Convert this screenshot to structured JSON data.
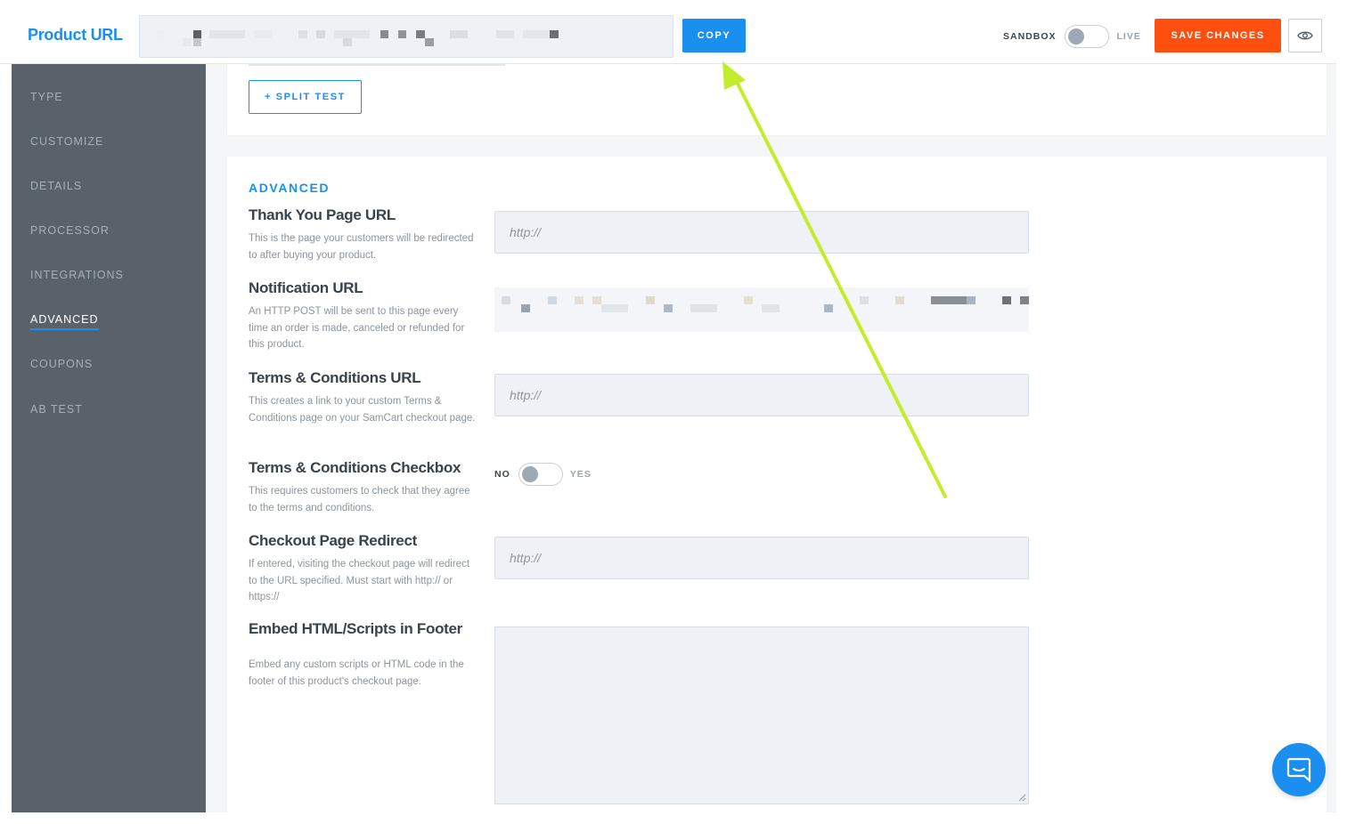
{
  "header": {
    "title": "Product URL",
    "copy_label": "COPY",
    "sandbox_label": "SANDBOX",
    "live_label": "LIVE",
    "save_label": "SAVE CHANGES",
    "eye_icon": "eye-icon",
    "mode": "sandbox"
  },
  "sidebar": {
    "items": [
      {
        "label": "TYPE"
      },
      {
        "label": "CUSTOMIZE"
      },
      {
        "label": "DETAILS"
      },
      {
        "label": "PROCESSOR"
      },
      {
        "label": "INTEGRATIONS"
      },
      {
        "label": "ADVANCED",
        "active": true
      },
      {
        "label": "COUPONS"
      },
      {
        "label": "AB TEST"
      }
    ]
  },
  "main": {
    "split_test_label": "+ SPLIT TEST",
    "section_title": "ADVANCED",
    "fields": {
      "thank_you": {
        "label": "Thank You Page URL",
        "desc": "This is the page your customers will be redirected to after buying your product.",
        "placeholder": "http://"
      },
      "notification": {
        "label": "Notification URL",
        "desc": "An HTTP POST will be sent to this page every time an order is made, canceled or refunded for this product."
      },
      "terms_url": {
        "label": "Terms & Conditions URL",
        "desc": "This creates a link to your custom Terms & Conditions page on your SamCart checkout page.",
        "placeholder": "http://"
      },
      "terms_checkbox": {
        "label": "Terms & Conditions Checkbox",
        "desc": "This requires customers to check that they agree to the terms and conditions.",
        "no_label": "NO",
        "yes_label": "YES",
        "value": "no"
      },
      "redirect": {
        "label": "Checkout Page Redirect",
        "desc": "If entered, visiting the checkout page will redirect to the URL specified. Must start with http:// or https://",
        "placeholder": "http://"
      },
      "embed": {
        "label": "Embed HTML/Scripts in Footer",
        "desc": "Embed any custom scripts or HTML code in the footer of this product's checkout page."
      }
    }
  },
  "chat": {
    "icon": "chat-icon"
  },
  "colors": {
    "accent": "#1a8ff0",
    "save": "#ff4f0f",
    "sidebar": "#59626b",
    "annotation_arrow": "#c3ec2c"
  }
}
